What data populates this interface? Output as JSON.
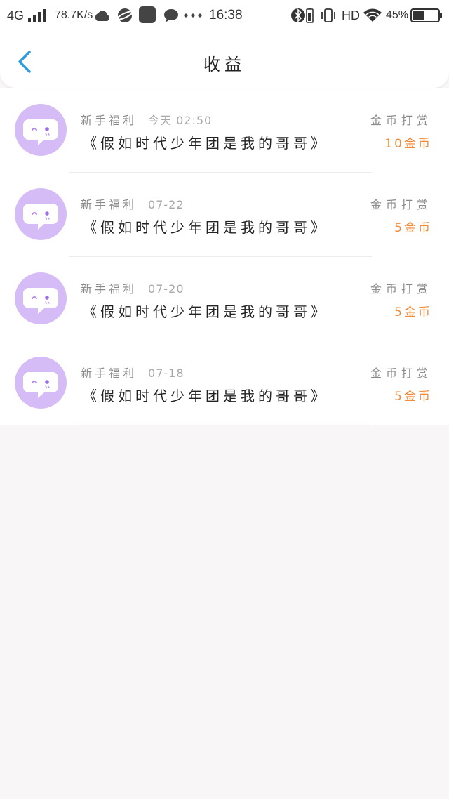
{
  "status_bar": {
    "network": "4G",
    "speed": "78.7K/s",
    "time": "16:38",
    "hd": "HD",
    "battery": "45%"
  },
  "header": {
    "title": "收益",
    "back_icon": "chevron-left-icon"
  },
  "colors": {
    "accent_blue": "#2e9be0",
    "amount_orange": "#f08a3c",
    "avatar_purple": "#d6bcf6"
  },
  "earnings": [
    {
      "source": "新手福利",
      "date": "今天 02:50",
      "title": "《假如时代少年团是我的哥哥》",
      "type": "金币打赏",
      "amount": "10金币"
    },
    {
      "source": "新手福利",
      "date": "07-22",
      "title": "《假如时代少年团是我的哥哥》",
      "type": "金币打赏",
      "amount": "5金币"
    },
    {
      "source": "新手福利",
      "date": "07-20",
      "title": "《假如时代少年团是我的哥哥》",
      "type": "金币打赏",
      "amount": "5金币"
    },
    {
      "source": "新手福利",
      "date": "07-18",
      "title": "《假如时代少年团是我的哥哥》",
      "type": "金币打赏",
      "amount": "5金币"
    }
  ]
}
